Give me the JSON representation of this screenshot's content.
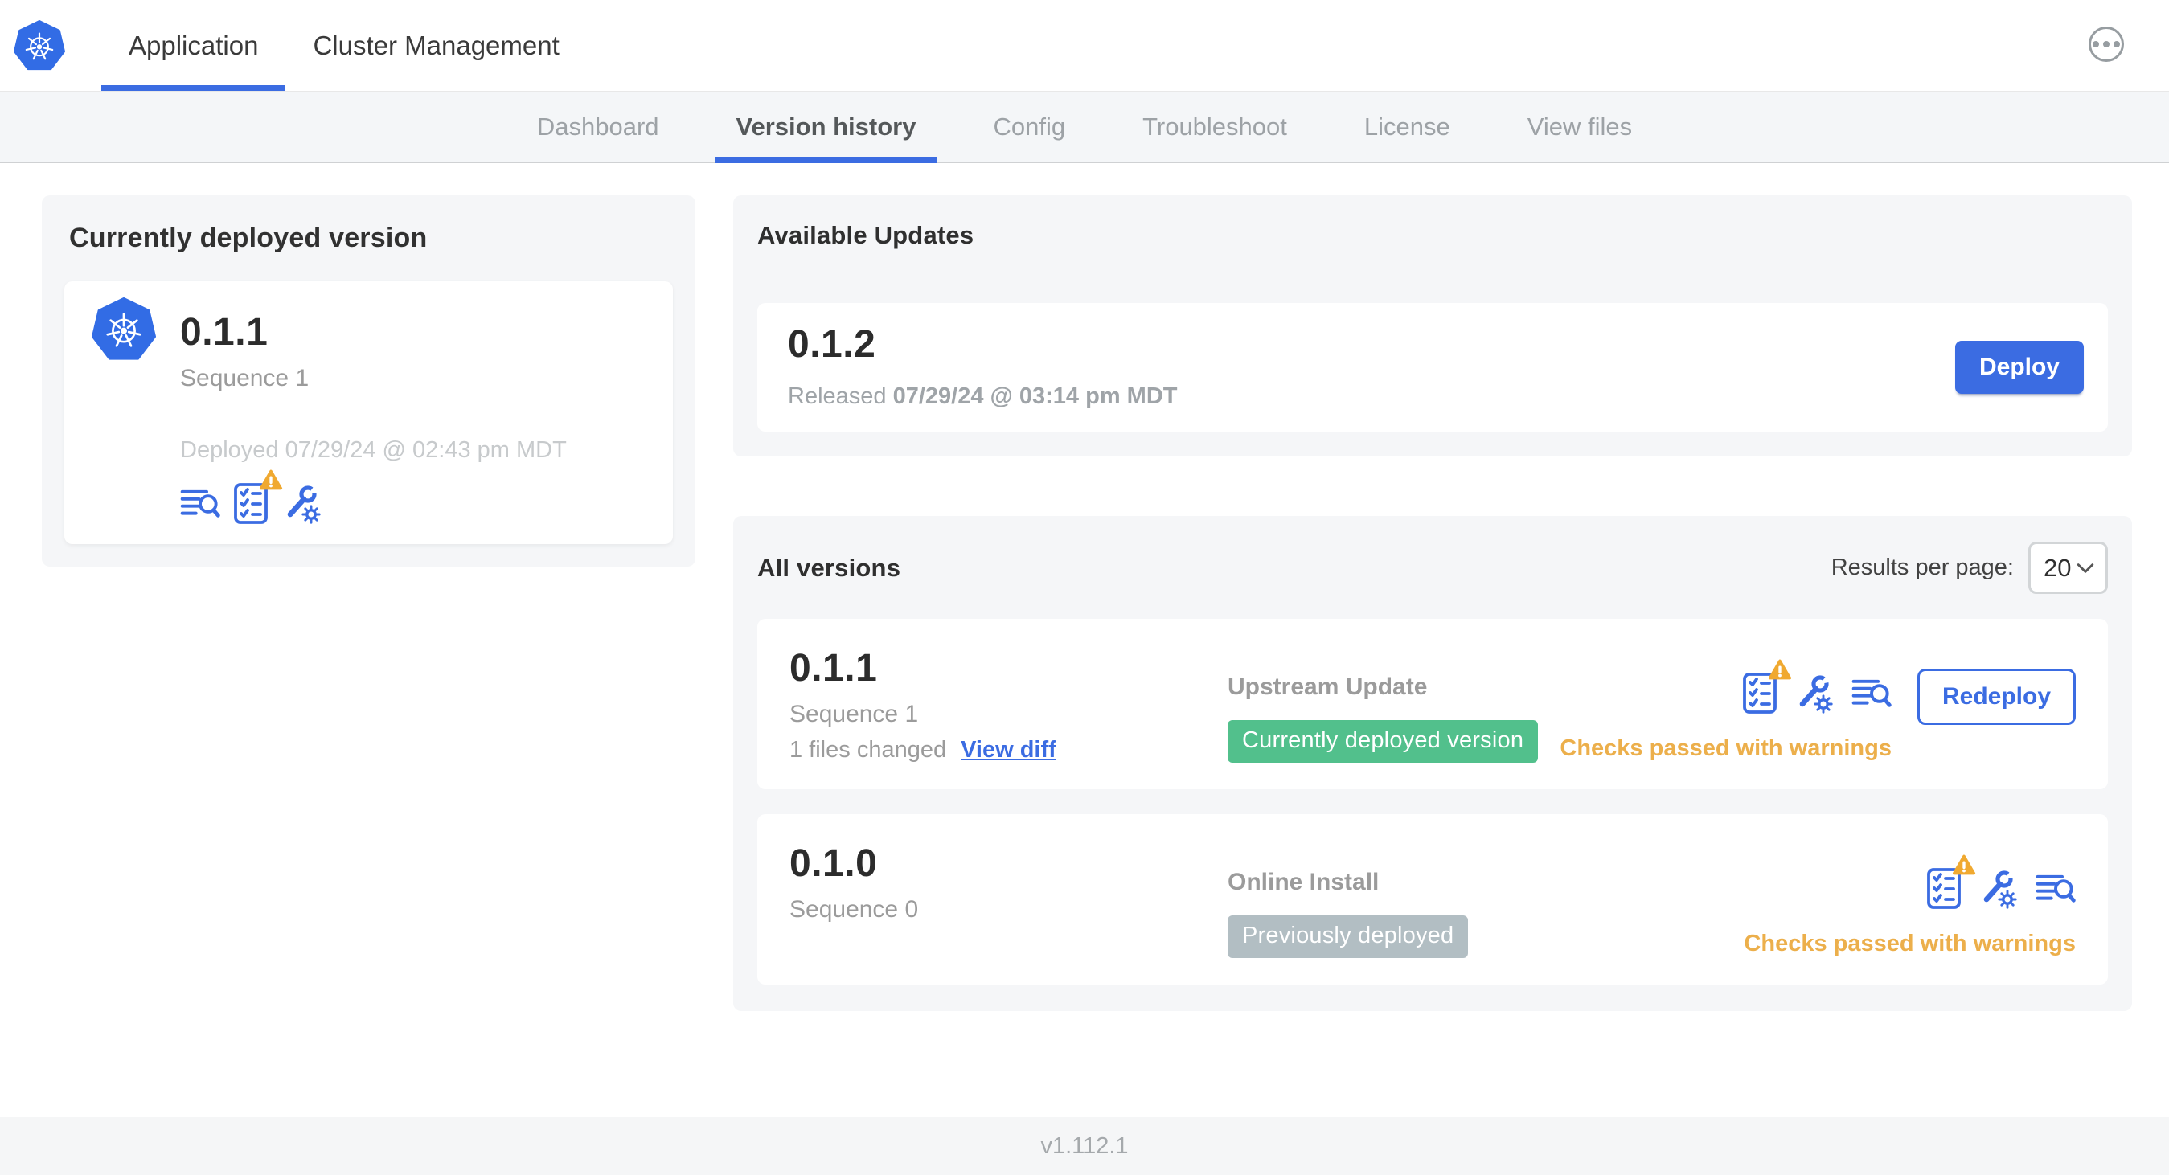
{
  "colors": {
    "accent": "#3b6ce2",
    "k8s_blue": "#326ce5",
    "green": "#52c08c",
    "gray_badge": "#b2bec3",
    "warning": "#ecaf4b",
    "warning_tri": "#f0a930"
  },
  "header": {
    "tabs": [
      {
        "label": "Application",
        "active": true
      },
      {
        "label": "Cluster Management",
        "active": false
      }
    ]
  },
  "subnav": {
    "tabs": [
      {
        "label": "Dashboard",
        "active": false
      },
      {
        "label": "Version history",
        "active": true
      },
      {
        "label": "Config",
        "active": false
      },
      {
        "label": "Troubleshoot",
        "active": false
      },
      {
        "label": "License",
        "active": false
      },
      {
        "label": "View files",
        "active": false
      }
    ]
  },
  "current_version": {
    "section_title": "Currently deployed version",
    "version": "0.1.1",
    "sequence": "Sequence 1",
    "deployed": "Deployed 07/29/24 @ 02:43 pm MDT"
  },
  "available_updates": {
    "section_title": "Available Updates",
    "version": "0.1.2",
    "released_prefix": "Released",
    "released_date": "07/29/24 @ 03:14 pm MDT",
    "deploy_label": "Deploy"
  },
  "all_versions": {
    "section_title": "All versions",
    "results_per_page_label": "Results per page:",
    "results_per_page_value": "20",
    "rows": [
      {
        "version": "0.1.1",
        "sequence": "Sequence 1",
        "files_changed": "1 files changed",
        "view_diff_label": "View diff",
        "source": "Upstream Update",
        "badge_label": "Currently deployed version",
        "status": "Checks passed with warnings",
        "action_label": "Redeploy"
      },
      {
        "version": "0.1.0",
        "sequence": "Sequence 0",
        "source": "Online Install",
        "badge_label": "Previously deployed",
        "status": "Checks passed with warnings"
      }
    ]
  },
  "footer": {
    "version": "v1.112.1"
  }
}
